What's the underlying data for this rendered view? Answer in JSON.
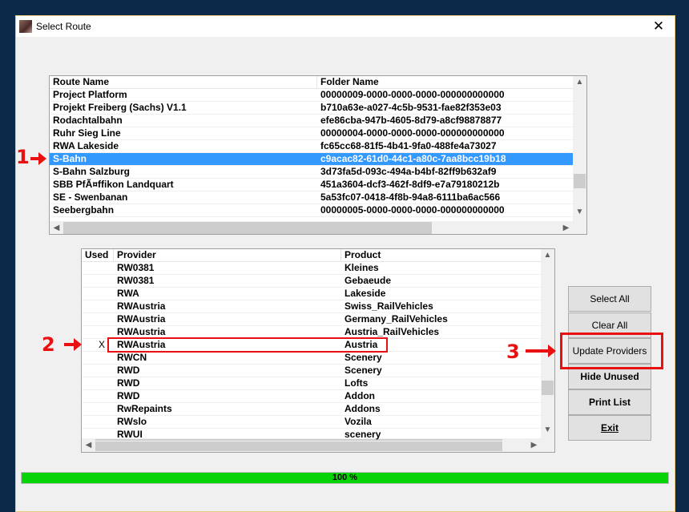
{
  "window": {
    "title": "Select Route",
    "close_glyph": "✕",
    "icon": "app-train-icon"
  },
  "routes": {
    "columns": [
      "Route Name",
      "Folder Name"
    ],
    "selected_index": 5,
    "rows": [
      [
        "Project Platform",
        "00000009-0000-0000-0000-000000000000"
      ],
      [
        "Projekt Freiberg (Sachs) V1.1",
        "b710a63e-a027-4c5b-9531-fae82f353e03"
      ],
      [
        "Rodachtalbahn",
        "efe86cba-947b-4605-8d79-a8cf98878877"
      ],
      [
        "Ruhr Sieg Line",
        "00000004-0000-0000-0000-000000000000"
      ],
      [
        "RWA Lakeside",
        "fc65cc68-81f5-4b41-9fa0-488fe4a73027"
      ],
      [
        "S-Bahn",
        "c9acac82-61d0-44c1-a80c-7aa8bcc19b18"
      ],
      [
        "S-Bahn Salzburg",
        "3d73fa5d-093c-494a-b4bf-82ff9b632af9"
      ],
      [
        "SBB PfÃ¤ffikon Landquart",
        "451a3604-dcf3-462f-8df9-e7a79180212b"
      ],
      [
        "SE - Swenbanan",
        "5a53fc07-0418-4f8b-94a8-6111ba6ac566"
      ],
      [
        "Seebergbahn",
        "00000005-0000-0000-0000-000000000000"
      ]
    ]
  },
  "providers": {
    "columns": [
      "Used",
      "Provider",
      "Product"
    ],
    "rows": [
      [
        "",
        "RW0381",
        "Kleines"
      ],
      [
        "",
        "RW0381",
        "Gebaeude"
      ],
      [
        "",
        "RWA",
        "Lakeside"
      ],
      [
        "",
        "RWAustria",
        "Swiss_RailVehicles"
      ],
      [
        "",
        "RWAustria",
        "Germany_RailVehicles"
      ],
      [
        "",
        "RWAustria",
        "Austria_RailVehicles"
      ],
      [
        "X",
        "RWAustria",
        "Austria"
      ],
      [
        "",
        "RWCN",
        "Scenery"
      ],
      [
        "",
        "RWD",
        "Scenery"
      ],
      [
        "",
        "RWD",
        "Lofts"
      ],
      [
        "",
        "RWD",
        "Addon"
      ],
      [
        "",
        "RwRepaints",
        "Addons"
      ],
      [
        "",
        "RWslo",
        "Vozila"
      ],
      [
        "",
        "RWUI",
        "scenery"
      ]
    ]
  },
  "buttons": {
    "select_all": "Select All",
    "clear_all": "Clear All",
    "update_providers": "Update Providers",
    "hide_unused": "Hide Unused",
    "print_list": "Print List",
    "exit": "Exit"
  },
  "progress": {
    "label": "100 %",
    "value_percent": 100
  },
  "annotations": {
    "one": "1",
    "two": "2",
    "three": "3"
  },
  "colors": {
    "selection": "#3399ff",
    "progress": "#06d406",
    "annotation": "#e81010"
  }
}
